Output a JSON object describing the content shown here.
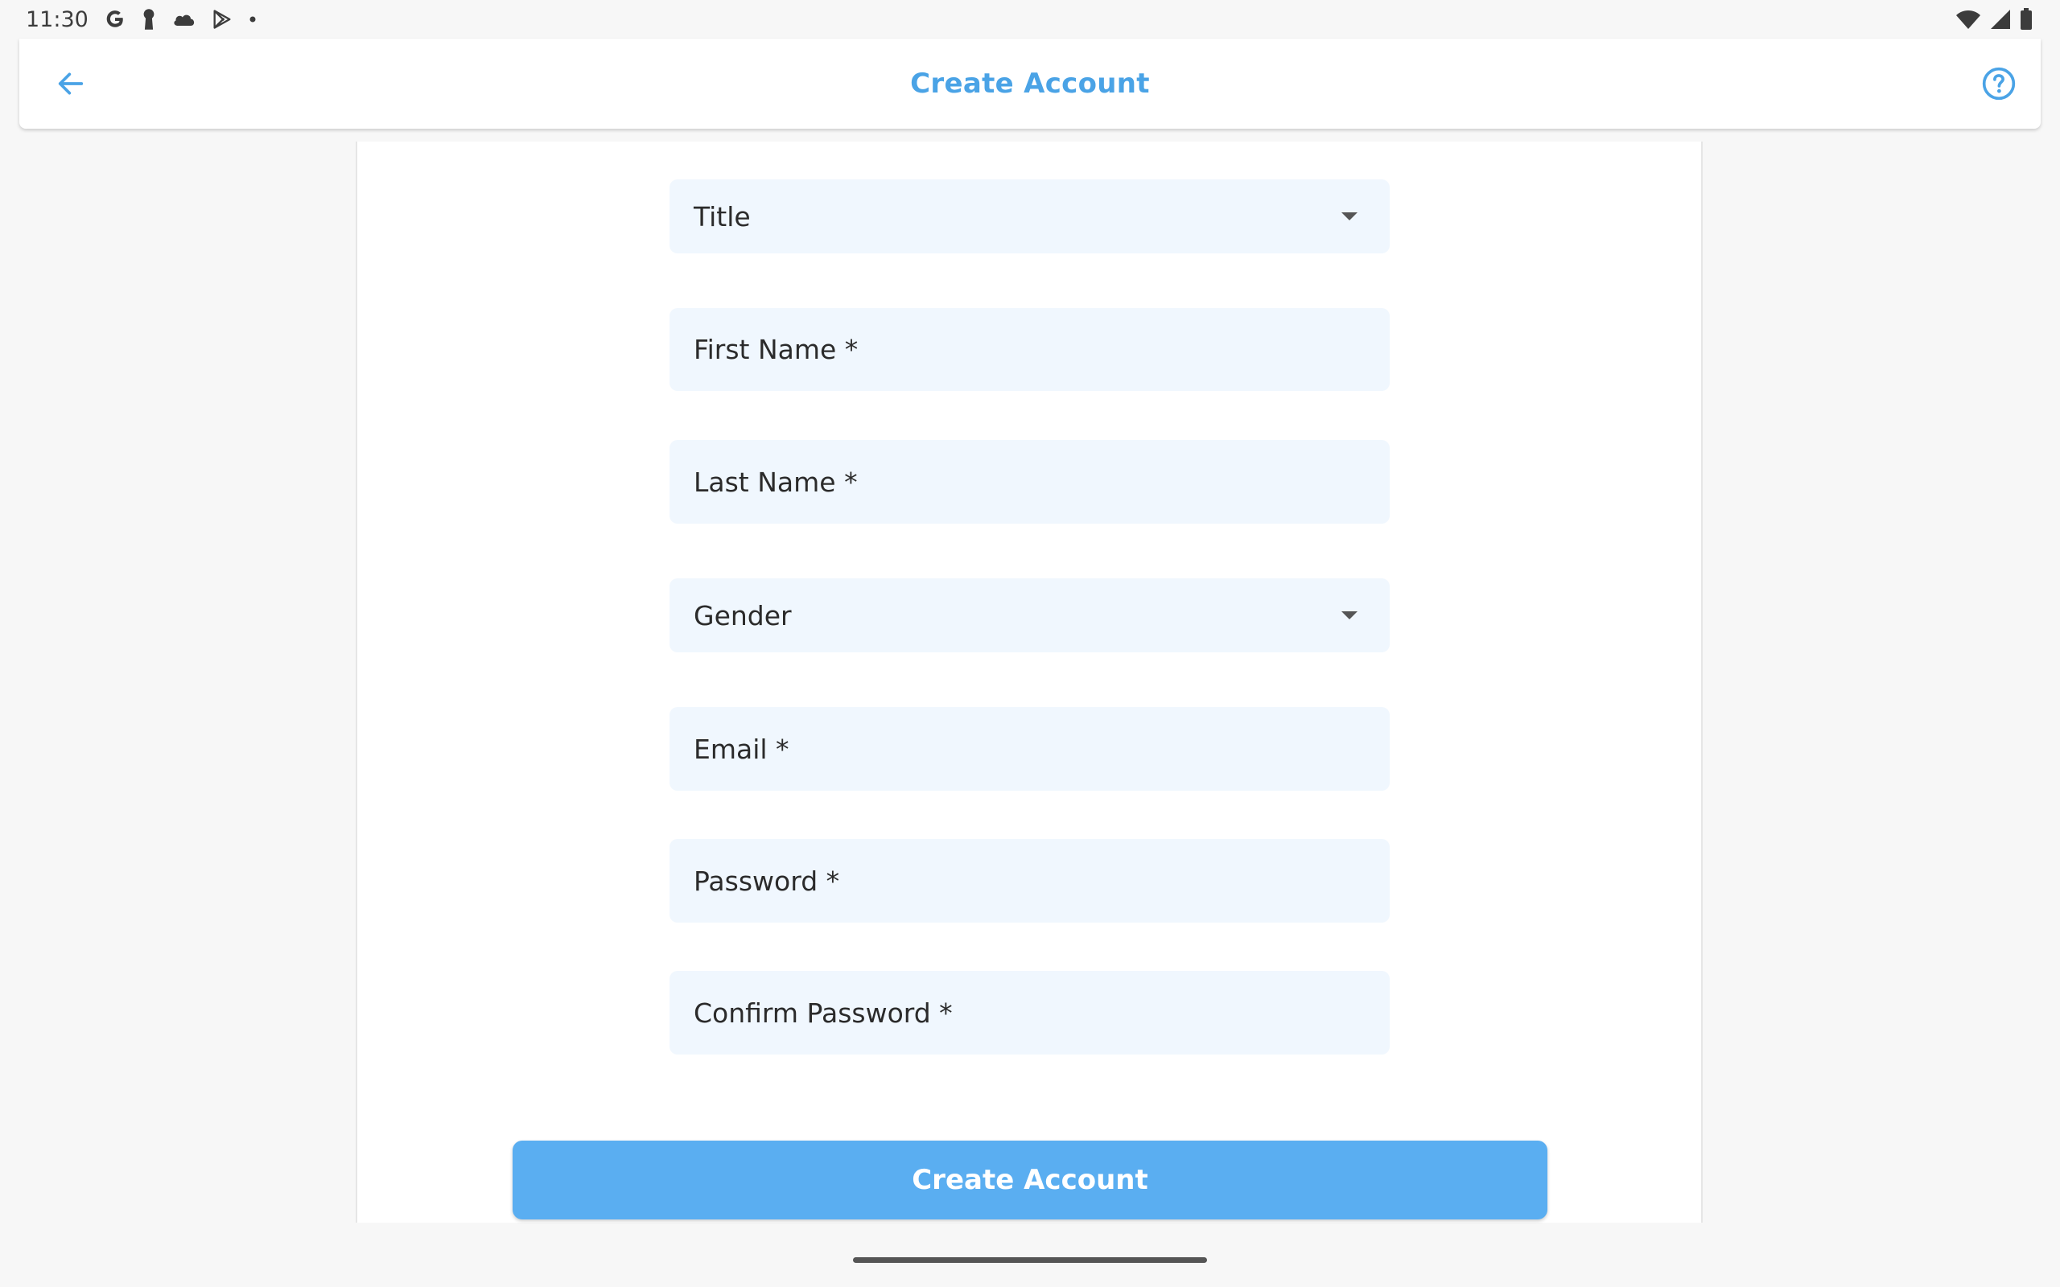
{
  "status_bar": {
    "time": "11:30",
    "icons": [
      "google-g-icon",
      "keyhole-icon",
      "cloud-icon",
      "play-store-icon",
      "dot-icon",
      "wifi-icon",
      "signal-icon",
      "battery-icon"
    ]
  },
  "app_bar": {
    "title": "Create Account",
    "back_icon": "arrow-left-icon",
    "help_icon": "help-circle-icon"
  },
  "form": {
    "title_select": {
      "label": "Title"
    },
    "first_name": {
      "label": "First Name *"
    },
    "last_name": {
      "label": "Last Name *"
    },
    "gender_select": {
      "label": "Gender"
    },
    "email": {
      "label": "Email *"
    },
    "password": {
      "label": "Password *"
    },
    "confirm_password": {
      "label": "Confirm Password *"
    },
    "submit_label": "Create Account"
  },
  "colors": {
    "accent": "#4aa3e6",
    "button": "#5aaef1",
    "field_background": "#f0f7fe",
    "page_background": "#f7f7f7"
  }
}
